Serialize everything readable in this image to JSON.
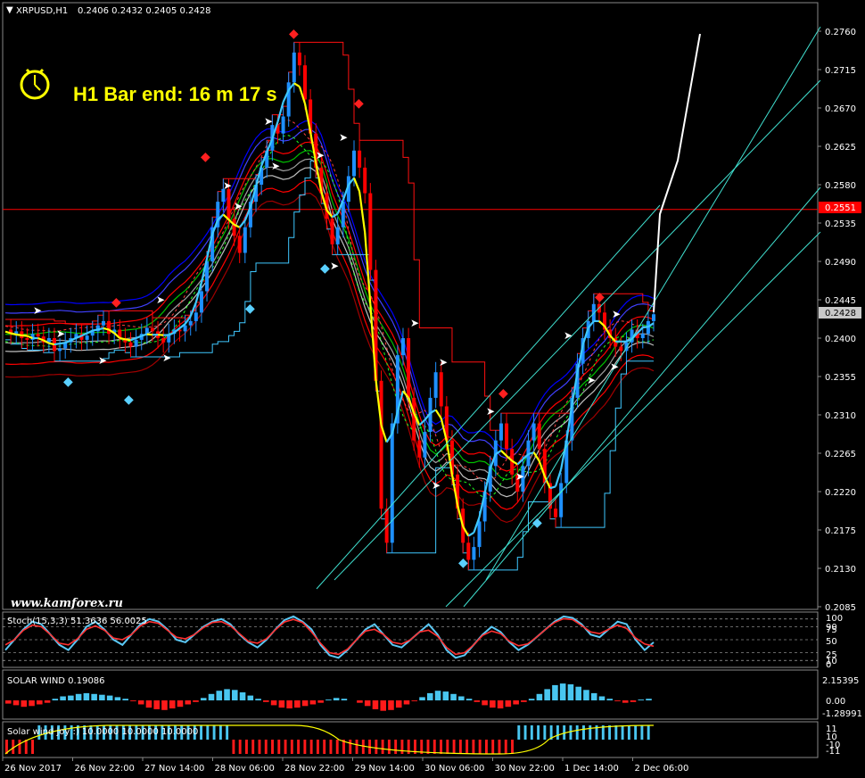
{
  "header": {
    "symbol": "XRPUSD,H1",
    "ohlc": "0.2406 0.2432 0.2405 0.2428"
  },
  "timer_text": "H1 Bar end: 16 m 17 s",
  "watermark": "www.kamforex.ru",
  "price_axis": {
    "ticks": [
      "0.2760",
      "0.2715",
      "0.2670",
      "0.2625",
      "0.2580",
      "0.2535",
      "0.2490",
      "0.2445",
      "0.2400",
      "0.2355",
      "0.2310",
      "0.2265",
      "0.2220",
      "0.2175",
      "0.2130",
      "0.2085"
    ],
    "hline_label": "0.2551",
    "current_label": "0.2428"
  },
  "time_axis": {
    "ticks": [
      "26 Nov 2017",
      "26 Nov 22:00",
      "27 Nov 14:00",
      "28 Nov 06:00",
      "28 Nov 22:00",
      "29 Nov 14:00",
      "30 Nov 06:00",
      "30 Nov 22:00",
      "1 Dec 14:00",
      "2 Dec 06:00"
    ]
  },
  "panels": {
    "stoch": {
      "title": "Stoch(15,3,3) 51.3636 56.0025",
      "ticks": [
        "100",
        "90",
        "75",
        "50",
        "25",
        "10",
        "0"
      ]
    },
    "solar": {
      "title": "SOLAR WIND 0.19086",
      "ticks": [
        "2.15395",
        "0.00",
        "-1.28991"
      ]
    },
    "joy": {
      "title": "Solar wind joy :) 10.0000 10.0000 10.0000",
      "ticks": [
        "11",
        "10",
        "-10",
        "-11"
      ]
    }
  },
  "colors": {
    "background": "#000000",
    "bull_candle": "#1e90ff",
    "bear_candle": "#ff0000",
    "hline": "#ff0000",
    "channel": "#40e0d0",
    "stoch_main": "#5bc8f5",
    "stoch_signal": "#ff3030",
    "histo_pos": "#49c6f0",
    "histo_neg": "#ff1a1a"
  },
  "chart_data": {
    "type": "candlestick",
    "title": "XRPUSD,H1",
    "ylim": [
      0.2085,
      0.276
    ],
    "hline": 0.2551,
    "last_price": 0.2428,
    "series": [
      {
        "name": "price",
        "values": [
          0.241,
          0.2405,
          0.2408,
          0.24,
          0.2398,
          0.2405,
          0.2402,
          0.2395,
          0.24,
          0.2385,
          0.2388,
          0.2395,
          0.24,
          0.2405,
          0.2398,
          0.2403,
          0.2408,
          0.2415,
          0.242,
          0.2405,
          0.241,
          0.24,
          0.2395,
          0.239,
          0.2398,
          0.2405,
          0.2412,
          0.2408,
          0.24,
          0.2395,
          0.2405,
          0.241,
          0.2408,
          0.2415,
          0.242,
          0.243,
          0.2455,
          0.249,
          0.253,
          0.256,
          0.2575,
          0.254,
          0.252,
          0.25,
          0.253,
          0.256,
          0.258,
          0.26,
          0.262,
          0.265,
          0.264,
          0.266,
          0.27,
          0.2735,
          0.272,
          0.268,
          0.264,
          0.26,
          0.257,
          0.254,
          0.251,
          0.253,
          0.256,
          0.259,
          0.262,
          0.26,
          0.257,
          0.248,
          0.235,
          0.22,
          0.216,
          0.23,
          0.238,
          0.24,
          0.233,
          0.228,
          0.226,
          0.229,
          0.233,
          0.236,
          0.232,
          0.228,
          0.224,
          0.22,
          0.216,
          0.214,
          0.2155,
          0.2185,
          0.222,
          0.225,
          0.228,
          0.23,
          0.227,
          0.224,
          0.222,
          0.225,
          0.228,
          0.23,
          0.227,
          0.223,
          0.22,
          0.219,
          0.223,
          0.228,
          0.233,
          0.237,
          0.24,
          0.242,
          0.244,
          0.243,
          0.241,
          0.24,
          0.239,
          0.2385,
          0.2395,
          0.241,
          0.24,
          0.2405,
          0.242,
          0.2428
        ]
      },
      {
        "name": "stoch",
        "values": [
          30,
          50,
          70,
          85,
          80,
          60,
          40,
          30,
          50,
          75,
          85,
          70,
          50,
          40,
          60,
          80,
          90,
          85,
          70,
          50,
          45,
          60,
          75,
          85,
          90,
          80,
          60,
          45,
          35,
          50,
          70,
          88,
          95,
          85,
          70,
          40,
          20,
          15,
          30,
          50,
          70,
          80,
          60,
          40,
          35,
          50,
          65,
          80,
          60,
          30,
          15,
          20,
          40,
          60,
          75,
          65,
          45,
          30,
          40,
          55,
          70,
          85,
          95,
          92,
          80,
          60,
          55,
          70,
          85,
          80,
          50,
          30,
          45
        ]
      },
      {
        "name": "solar wind",
        "values": [
          -0.4,
          -0.6,
          -0.8,
          -0.7,
          -0.5,
          -0.3,
          0.2,
          0.5,
          0.6,
          0.8,
          0.9,
          0.8,
          0.7,
          0.6,
          0.4,
          0.2,
          -0.1,
          -0.5,
          -0.9,
          -1.1,
          -1.2,
          -1.0,
          -0.8,
          -0.5,
          -0.2,
          0.3,
          0.8,
          1.2,
          1.4,
          1.3,
          1.0,
          0.6,
          0.2,
          -0.2,
          -0.6,
          -0.9,
          -1.0,
          -0.9,
          -0.7,
          -0.5,
          -0.3,
          0.1,
          0.3,
          0.2,
          0.0,
          -0.3,
          -0.7,
          -1.1,
          -1.3,
          -1.2,
          -0.9,
          -0.5,
          -0.1,
          0.4,
          0.9,
          1.2,
          1.1,
          0.8,
          0.5,
          0.2,
          -0.2,
          -0.6,
          -0.9,
          -1.0,
          -0.8,
          -0.5,
          -0.2,
          0.2,
          0.8,
          1.4,
          1.9,
          2.1,
          2.0,
          1.7,
          1.3,
          0.9,
          0.5,
          0.2,
          -0.1,
          -0.3,
          -0.2,
          0.1,
          0.2
        ]
      },
      {
        "name": "solar wind joy",
        "values": [
          -10,
          -10,
          -10,
          -10,
          -10,
          10,
          10,
          10,
          10,
          10,
          10,
          10,
          10,
          10,
          10,
          10,
          10,
          10,
          10,
          10,
          10,
          10,
          10,
          10,
          10,
          10,
          10,
          10,
          10,
          10,
          10,
          10,
          10,
          10,
          10,
          -10,
          -10,
          -10,
          -10,
          -10,
          -10,
          -10,
          -10,
          -10,
          -10,
          -10,
          -10,
          -10,
          -10,
          -10,
          -10,
          -10,
          -10,
          -10,
          -10,
          -10,
          -10,
          -10,
          -10,
          -10,
          -10,
          -10,
          -10,
          -10,
          -10,
          -10,
          -10,
          -10,
          -10,
          -10,
          -10,
          -10,
          -10,
          -10,
          -10,
          -10,
          -10,
          -10,
          -10,
          10,
          10,
          10,
          10,
          10,
          10,
          10,
          10,
          10,
          10,
          10,
          10,
          10,
          10,
          10,
          10,
          10,
          10,
          10,
          10,
          10
        ]
      }
    ]
  }
}
